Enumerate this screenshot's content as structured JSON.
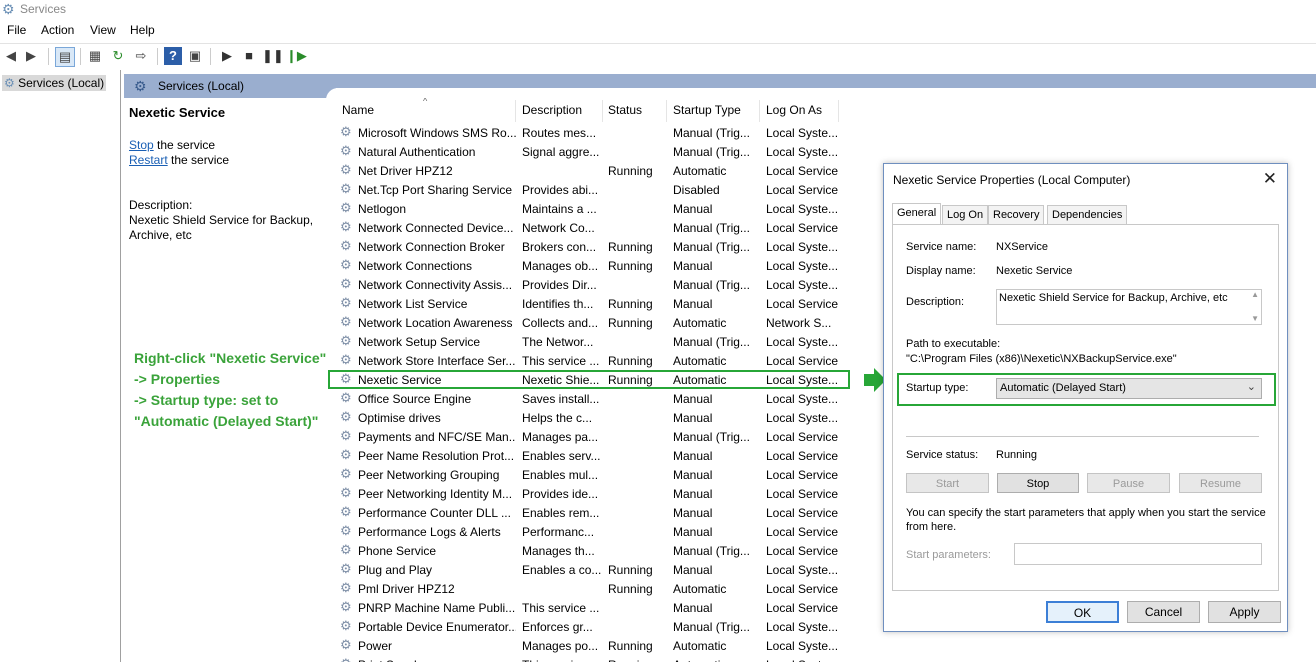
{
  "window": {
    "title": "Services"
  },
  "menu": [
    "File",
    "Action",
    "View",
    "Help"
  ],
  "tree": {
    "node": "Services (Local)"
  },
  "main_header": "Services (Local)",
  "desc_panel": {
    "title": "Nexetic Service",
    "stop_link": "Stop",
    "stop_rest": " the service",
    "restart_link": "Restart",
    "restart_rest": " the service",
    "desc_label": "Description:",
    "desc_text1": "Nexetic Shield Service for Backup,",
    "desc_text2": "Archive, etc"
  },
  "annotation": [
    "Right-click \"Nexetic Service\"",
    "-> Properties",
    "-> Startup type: set to",
    "\"Automatic (Delayed Start)\""
  ],
  "columns": [
    "Name",
    "Description",
    "Status",
    "Startup Type",
    "Log On As"
  ],
  "services": [
    {
      "name": "Microsoft Windows SMS Ro...",
      "desc": "Routes mes...",
      "status": "",
      "startup": "Manual (Trig...",
      "logon": "Local Syste..."
    },
    {
      "name": "Natural Authentication",
      "desc": "Signal aggre...",
      "status": "",
      "startup": "Manual (Trig...",
      "logon": "Local Syste..."
    },
    {
      "name": "Net Driver HPZ12",
      "desc": "",
      "status": "Running",
      "startup": "Automatic",
      "logon": "Local Service"
    },
    {
      "name": "Net.Tcp Port Sharing Service",
      "desc": "Provides abi...",
      "status": "",
      "startup": "Disabled",
      "logon": "Local Service"
    },
    {
      "name": "Netlogon",
      "desc": "Maintains a ...",
      "status": "",
      "startup": "Manual",
      "logon": "Local Syste..."
    },
    {
      "name": "Network Connected Device...",
      "desc": "Network Co...",
      "status": "",
      "startup": "Manual (Trig...",
      "logon": "Local Service"
    },
    {
      "name": "Network Connection Broker",
      "desc": "Brokers con...",
      "status": "Running",
      "startup": "Manual (Trig...",
      "logon": "Local Syste..."
    },
    {
      "name": "Network Connections",
      "desc": "Manages ob...",
      "status": "Running",
      "startup": "Manual",
      "logon": "Local Syste..."
    },
    {
      "name": "Network Connectivity Assis...",
      "desc": "Provides Dir...",
      "status": "",
      "startup": "Manual (Trig...",
      "logon": "Local Syste..."
    },
    {
      "name": "Network List Service",
      "desc": "Identifies th...",
      "status": "Running",
      "startup": "Manual",
      "logon": "Local Service"
    },
    {
      "name": "Network Location Awareness",
      "desc": "Collects and...",
      "status": "Running",
      "startup": "Automatic",
      "logon": "Network S..."
    },
    {
      "name": "Network Setup Service",
      "desc": "The Networ...",
      "status": "",
      "startup": "Manual (Trig...",
      "logon": "Local Syste..."
    },
    {
      "name": "Network Store Interface Ser...",
      "desc": "This service ...",
      "status": "Running",
      "startup": "Automatic",
      "logon": "Local Service"
    },
    {
      "name": "Nexetic Service",
      "desc": "Nexetic Shie...",
      "status": "Running",
      "startup": "Automatic",
      "logon": "Local Syste..."
    },
    {
      "name": "Office  Source Engine",
      "desc": "Saves install...",
      "status": "",
      "startup": "Manual",
      "logon": "Local Syste..."
    },
    {
      "name": "Optimise drives",
      "desc": "Helps the c...",
      "status": "",
      "startup": "Manual",
      "logon": "Local Syste..."
    },
    {
      "name": "Payments and NFC/SE Man...",
      "desc": "Manages pa...",
      "status": "",
      "startup": "Manual (Trig...",
      "logon": "Local Service"
    },
    {
      "name": "Peer Name Resolution Prot...",
      "desc": "Enables serv...",
      "status": "",
      "startup": "Manual",
      "logon": "Local Service"
    },
    {
      "name": "Peer Networking Grouping",
      "desc": "Enables mul...",
      "status": "",
      "startup": "Manual",
      "logon": "Local Service"
    },
    {
      "name": "Peer Networking Identity M...",
      "desc": "Provides ide...",
      "status": "",
      "startup": "Manual",
      "logon": "Local Service"
    },
    {
      "name": "Performance Counter DLL ...",
      "desc": "Enables rem...",
      "status": "",
      "startup": "Manual",
      "logon": "Local Service"
    },
    {
      "name": "Performance Logs & Alerts",
      "desc": "Performanc...",
      "status": "",
      "startup": "Manual",
      "logon": "Local Service"
    },
    {
      "name": "Phone Service",
      "desc": "Manages th...",
      "status": "",
      "startup": "Manual (Trig...",
      "logon": "Local Service"
    },
    {
      "name": "Plug and Play",
      "desc": "Enables a co...",
      "status": "Running",
      "startup": "Manual",
      "logon": "Local Syste..."
    },
    {
      "name": "Pml Driver HPZ12",
      "desc": "",
      "status": "Running",
      "startup": "Automatic",
      "logon": "Local Service"
    },
    {
      "name": "PNRP Machine Name Publi...",
      "desc": "This service ...",
      "status": "",
      "startup": "Manual",
      "logon": "Local Service"
    },
    {
      "name": "Portable Device Enumerator...",
      "desc": "Enforces gr...",
      "status": "",
      "startup": "Manual (Trig...",
      "logon": "Local Syste..."
    },
    {
      "name": "Power",
      "desc": "Manages po...",
      "status": "Running",
      "startup": "Automatic",
      "logon": "Local Syste..."
    },
    {
      "name": "Print Spooler",
      "desc": "This service ...",
      "status": "Running",
      "startup": "Automatic",
      "logon": "Local Syste..."
    }
  ],
  "dialog": {
    "title": "Nexetic Service Properties (Local Computer)",
    "tabs": [
      "General",
      "Log On",
      "Recovery",
      "Dependencies"
    ],
    "service_name_label": "Service name:",
    "service_name": "NXService",
    "display_name_label": "Display name:",
    "display_name": "Nexetic Service",
    "description_label": "Description:",
    "description": "Nexetic Shield Service for Backup, Archive, etc",
    "path_label": "Path to executable:",
    "path": "\"C:\\Program Files (x86)\\Nexetic\\NXBackupService.exe\"",
    "startup_label": "Startup type:",
    "startup_value": "Automatic (Delayed Start)",
    "status_label": "Service status:",
    "status_value": "Running",
    "btn_start": "Start",
    "btn_stop": "Stop",
    "btn_pause": "Pause",
    "btn_resume": "Resume",
    "hint1": "You can specify the start parameters that apply when you start the service",
    "hint2": "from here.",
    "params_label": "Start parameters:",
    "params_value": "",
    "ok": "OK",
    "cancel": "Cancel",
    "apply": "Apply"
  },
  "colors": {
    "highlight": "#27a637",
    "header_bg": "#9aaecf"
  }
}
